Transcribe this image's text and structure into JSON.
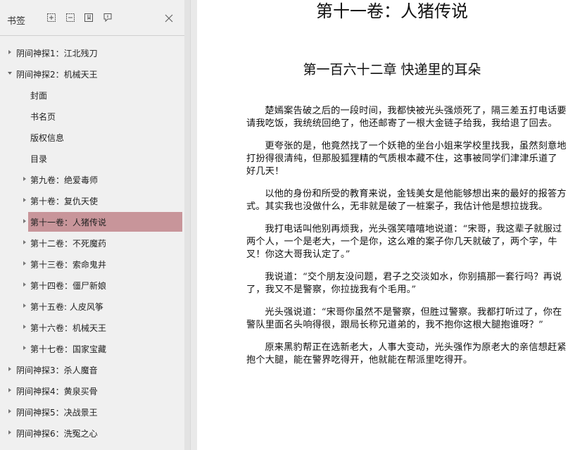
{
  "sidebar": {
    "title": "书签",
    "toolbar_icons": [
      "expand-all-icon",
      "collapse-all-icon",
      "add-bookmark-icon",
      "bookmark-options-icon"
    ],
    "close_icon": "close-icon",
    "items": [
      {
        "label": "阴间神探1：江北残刀",
        "level": 0,
        "arrow": "right"
      },
      {
        "label": "阴间神探2：机械天王",
        "level": 0,
        "arrow": "down"
      },
      {
        "label": "封面",
        "level": 1,
        "arrow": "none"
      },
      {
        "label": "书名页",
        "level": 1,
        "arrow": "none"
      },
      {
        "label": "版权信息",
        "level": 1,
        "arrow": "none"
      },
      {
        "label": "目录",
        "level": 1,
        "arrow": "none"
      },
      {
        "label": "第九卷：绝爱毒师",
        "level": 1,
        "arrow": "right"
      },
      {
        "label": "第十卷：复仇天使",
        "level": 1,
        "arrow": "right"
      },
      {
        "label": "第十一卷：人猪传说",
        "level": 1,
        "arrow": "right",
        "selected": true
      },
      {
        "label": "第十二卷：不死魔药",
        "level": 1,
        "arrow": "right"
      },
      {
        "label": "第十三卷：索命鬼井",
        "level": 1,
        "arrow": "right"
      },
      {
        "label": "第十四卷：僵尸新娘",
        "level": 1,
        "arrow": "right"
      },
      {
        "label": "第十五卷: 人皮风筝",
        "level": 1,
        "arrow": "right"
      },
      {
        "label": "第十六卷：机械天王",
        "level": 1,
        "arrow": "right"
      },
      {
        "label": "第十七卷：国家宝藏",
        "level": 1,
        "arrow": "right"
      },
      {
        "label": "阴间神探3：杀人魔音",
        "level": 0,
        "arrow": "right"
      },
      {
        "label": "阴间神探4：黄泉买骨",
        "level": 0,
        "arrow": "right"
      },
      {
        "label": "阴间神探5：决战景王",
        "level": 0,
        "arrow": "right"
      },
      {
        "label": "阴间神探6：洗冤之心",
        "level": 0,
        "arrow": "right"
      }
    ],
    "selected_color": "#c8959a"
  },
  "document": {
    "volume_title": "第十一卷：人猪传说",
    "chapter_title": "第一百六十二章 快递里的耳朵",
    "paragraphs": [
      "楚嫣案告破之后的一段时间，我都快被光头强烦死了，隔三差五打电话要请我吃饭，我统统回绝了，他还邮寄了一根大金链子给我，我给退了回去。",
      "更夸张的是，他竟然找了一个妖艳的坐台小姐来学校里找我，虽然刻意地打扮得很清纯，但那股狐狸精的气质根本藏不住，这事被同学们津津乐道了好几天！",
      "以他的身份和所受的教育来说，金钱美女是他能够想出来的最好的报答方式。其实我也没做什么，无非就是破了一桩案子，我估计他是想拉拢我。",
      "我打电话叫他别再烦我，光头强笑嘻嘻地说道：“宋哥，我这辈子就服过两个人，一个是老大，一个是你，这么难的案子你几天就破了，两个字，牛叉！你这大哥我认定了。”",
      "我说道：“交个朋友没问题，君子之交淡如水，你别搞那一套行吗？再说了，我又不是警察，你拉拢我有个毛用。”",
      "光头强说道：“宋哥你虽然不是警察，但胜过警察。我都打听过了，你在警队里面名头响得很，跟局长称兄道弟的，我不抱你这根大腿抱谁呀？”",
      "原来黑豹帮正在选新老大，人事大变动，光头强作为原老大的亲信想赶紧抱个大腿，能在警界吃得开，他就能在帮派里吃得开。"
    ]
  }
}
